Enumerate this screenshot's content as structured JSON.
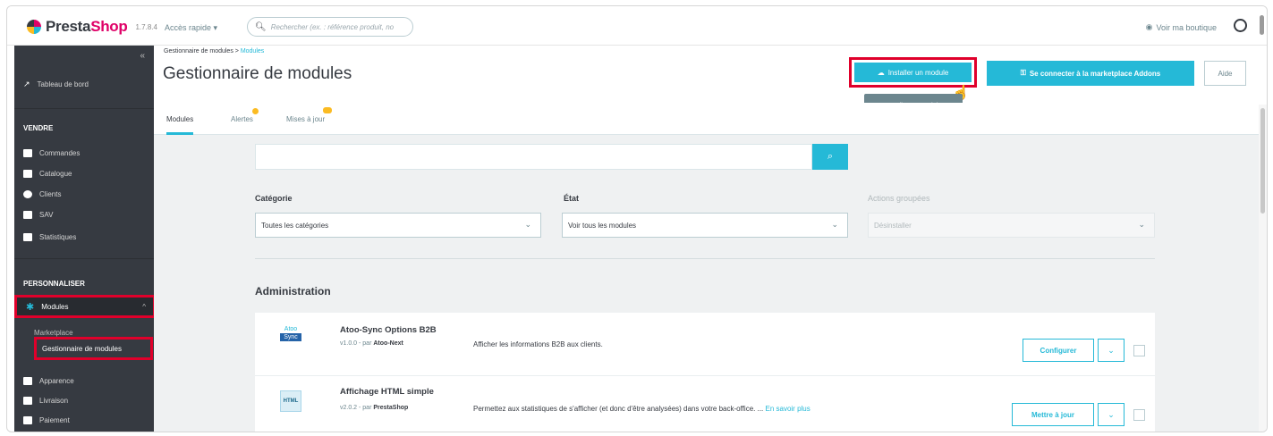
{
  "header": {
    "logo_text_a": "Presta",
    "logo_text_b": "Shop",
    "version": "1.7.8.4",
    "quick_access": "Accès rapide ▾",
    "search_placeholder": "Rechercher (ex. : référence produit, no",
    "view_shop": "Voir ma boutique"
  },
  "sidebar": {
    "collapse": "«",
    "dashboard": "Tableau de bord",
    "sell_heading": "VENDRE",
    "sell_items": [
      "Commandes",
      "Catalogue",
      "Clients",
      "SAV",
      "Statistiques"
    ],
    "personalize_heading": "PERSONNALISER",
    "modules": "Modules",
    "modules_caret": "^",
    "sub_marketplace": "Marketplace",
    "sub_manager": "Gestionnaire de modules",
    "after_items": [
      "Apparence",
      "Livraison",
      "Paiement"
    ]
  },
  "page": {
    "breadcrumb_root": "Gestionnaire de modules",
    "breadcrumb_sep": " > ",
    "breadcrumb_current": "Modules",
    "title": "Gestionnaire de modules",
    "install_button": "Installer un module",
    "connect_button": "Se connecter à la marketplace Addons",
    "help_button": "Aide",
    "tooltip": "Installer un module"
  },
  "tabs": [
    "Modules",
    "Alertes",
    "Mises à jour"
  ],
  "filters": {
    "search_button": "🔍",
    "category_label": "Catégorie",
    "category_value": "Toutes les catégories",
    "state_label": "État",
    "state_value": "Voir tous les modules",
    "bulk_label": "Actions groupées",
    "bulk_value": "Désinstaller"
  },
  "section_title": "Administration",
  "modules": [
    {
      "logo_top": "Atoo",
      "logo_bottom": "Sync",
      "name": "Atoo-Sync Options B2B",
      "version": "v1.0.0 - par",
      "author": "Atoo-Next",
      "description": "Afficher les informations B2B aux clients.",
      "action": "Configurer"
    },
    {
      "logo_top": "HTML",
      "name": "Affichage HTML simple",
      "version": "v2.0.2 - par",
      "author": "PrestaShop",
      "description": "Permettez aux statistiques de s'afficher (et donc d'être analysées) dans votre back-office. ...",
      "more": "En savoir plus",
      "action": "Mettre à jour"
    }
  ],
  "colors": {
    "accent": "#25b9d7",
    "highlight": "#e0002b",
    "sidebar": "#363a41",
    "brand": "#df0067"
  }
}
